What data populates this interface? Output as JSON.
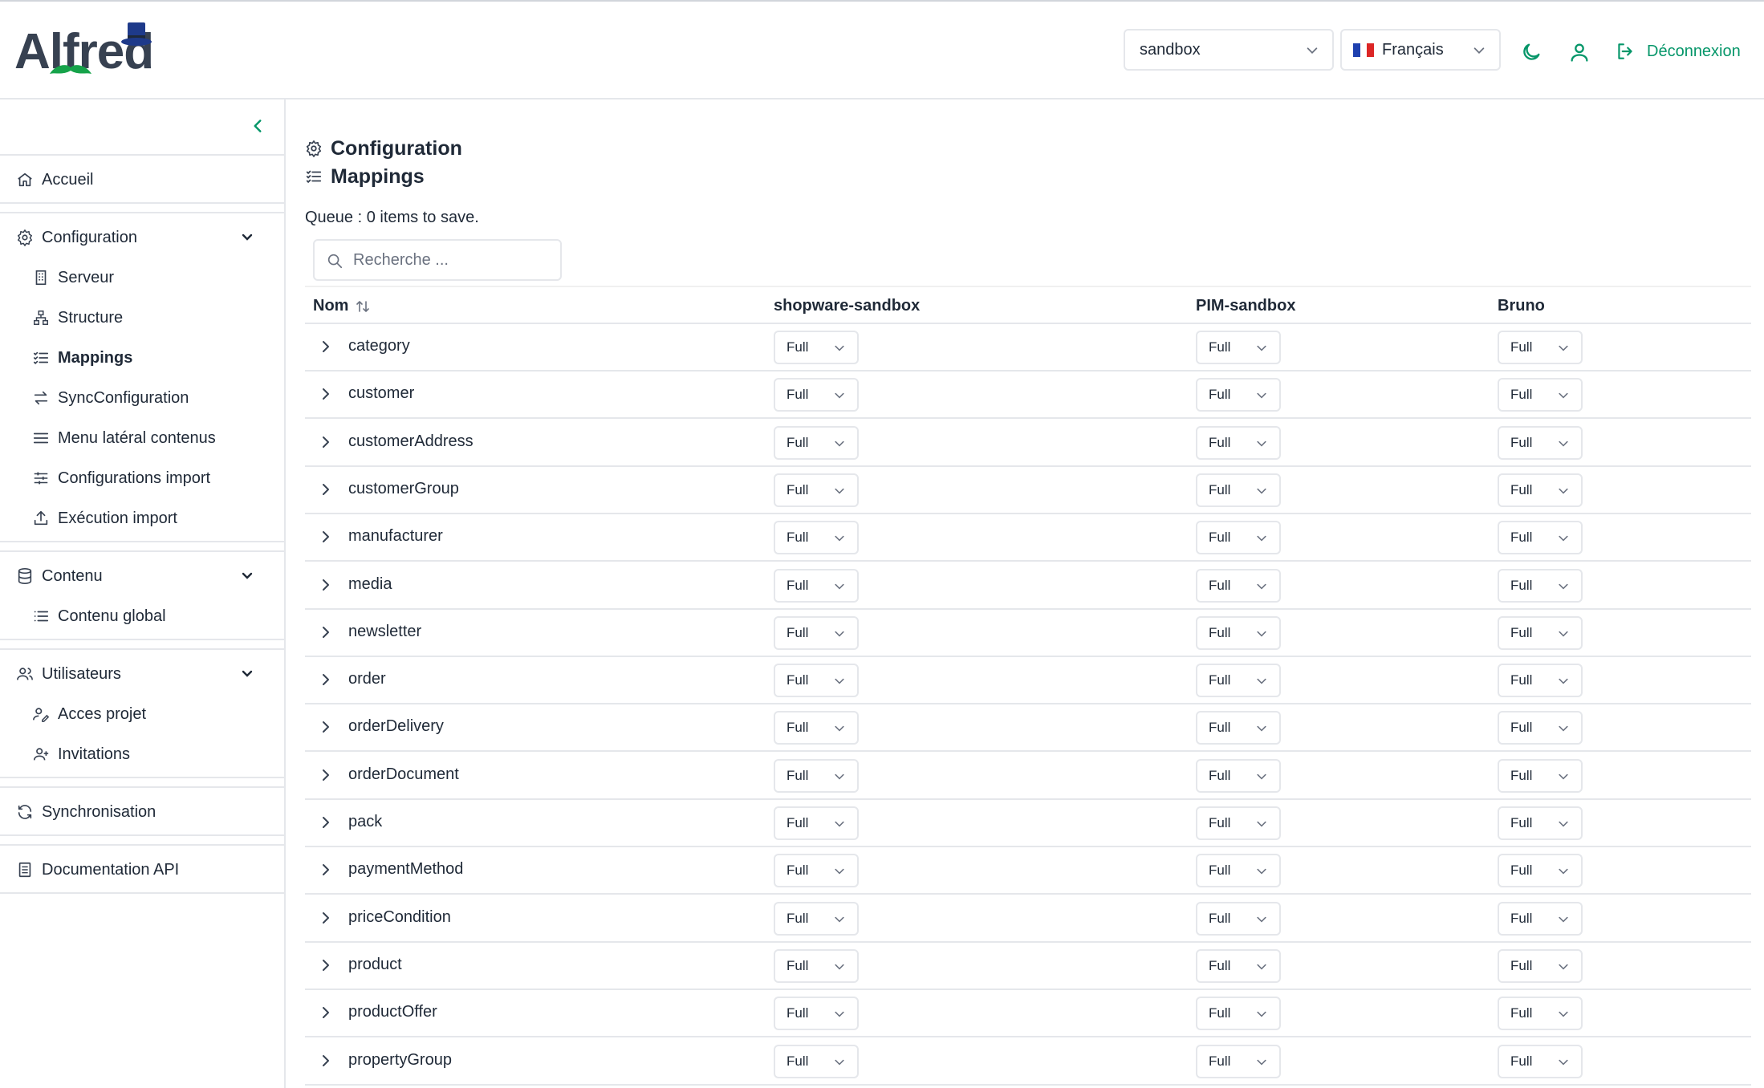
{
  "app": {
    "logo_text": "Alfred"
  },
  "header": {
    "env_select": "sandbox",
    "lang_select": "Français",
    "logout_label": "Déconnexion"
  },
  "sidebar": {
    "home": "Accueil",
    "config": {
      "label": "Configuration",
      "items": [
        "Serveur",
        "Structure",
        "Mappings",
        "SyncConfiguration",
        "Menu latéral contenus",
        "Configurations import",
        "Exécution import"
      ]
    },
    "content": {
      "label": "Contenu",
      "items": [
        "Contenu global"
      ]
    },
    "users": {
      "label": "Utilisateurs",
      "items": [
        "Acces projet",
        "Invitations"
      ]
    },
    "sync": "Synchronisation",
    "api_docs": "Documentation API"
  },
  "main": {
    "title": "Configuration",
    "subtitle": "Mappings",
    "queue": "Queue : 0 items to save.",
    "search_placeholder": "Recherche ...",
    "columns": [
      "Nom",
      "shopware-sandbox",
      "PIM-sandbox",
      "Bruno"
    ],
    "rows": [
      {
        "name": "category",
        "values": [
          "Full",
          "Full",
          "Full"
        ]
      },
      {
        "name": "customer",
        "values": [
          "Full",
          "Full",
          "Full"
        ]
      },
      {
        "name": "customerAddress",
        "values": [
          "Full",
          "Full",
          "Full"
        ]
      },
      {
        "name": "customerGroup",
        "values": [
          "Full",
          "Full",
          "Full"
        ]
      },
      {
        "name": "manufacturer",
        "values": [
          "Full",
          "Full",
          "Full"
        ]
      },
      {
        "name": "media",
        "values": [
          "Full",
          "Full",
          "Full"
        ]
      },
      {
        "name": "newsletter",
        "values": [
          "Full",
          "Full",
          "Full"
        ]
      },
      {
        "name": "order",
        "values": [
          "Full",
          "Full",
          "Full"
        ]
      },
      {
        "name": "orderDelivery",
        "values": [
          "Full",
          "Full",
          "Full"
        ]
      },
      {
        "name": "orderDocument",
        "values": [
          "Full",
          "Full",
          "Full"
        ]
      },
      {
        "name": "pack",
        "values": [
          "Full",
          "Full",
          "Full"
        ]
      },
      {
        "name": "paymentMethod",
        "values": [
          "Full",
          "Full",
          "Full"
        ]
      },
      {
        "name": "priceCondition",
        "values": [
          "Full",
          "Full",
          "Full"
        ]
      },
      {
        "name": "product",
        "values": [
          "Full",
          "Full",
          "Full"
        ]
      },
      {
        "name": "productOffer",
        "values": [
          "Full",
          "Full",
          "Full"
        ]
      },
      {
        "name": "propertyGroup",
        "values": [
          "Full",
          "Full",
          "Full"
        ]
      }
    ]
  },
  "colors": {
    "accent": "#059669",
    "border": "#e5e7eb",
    "text": "#1f2937"
  }
}
